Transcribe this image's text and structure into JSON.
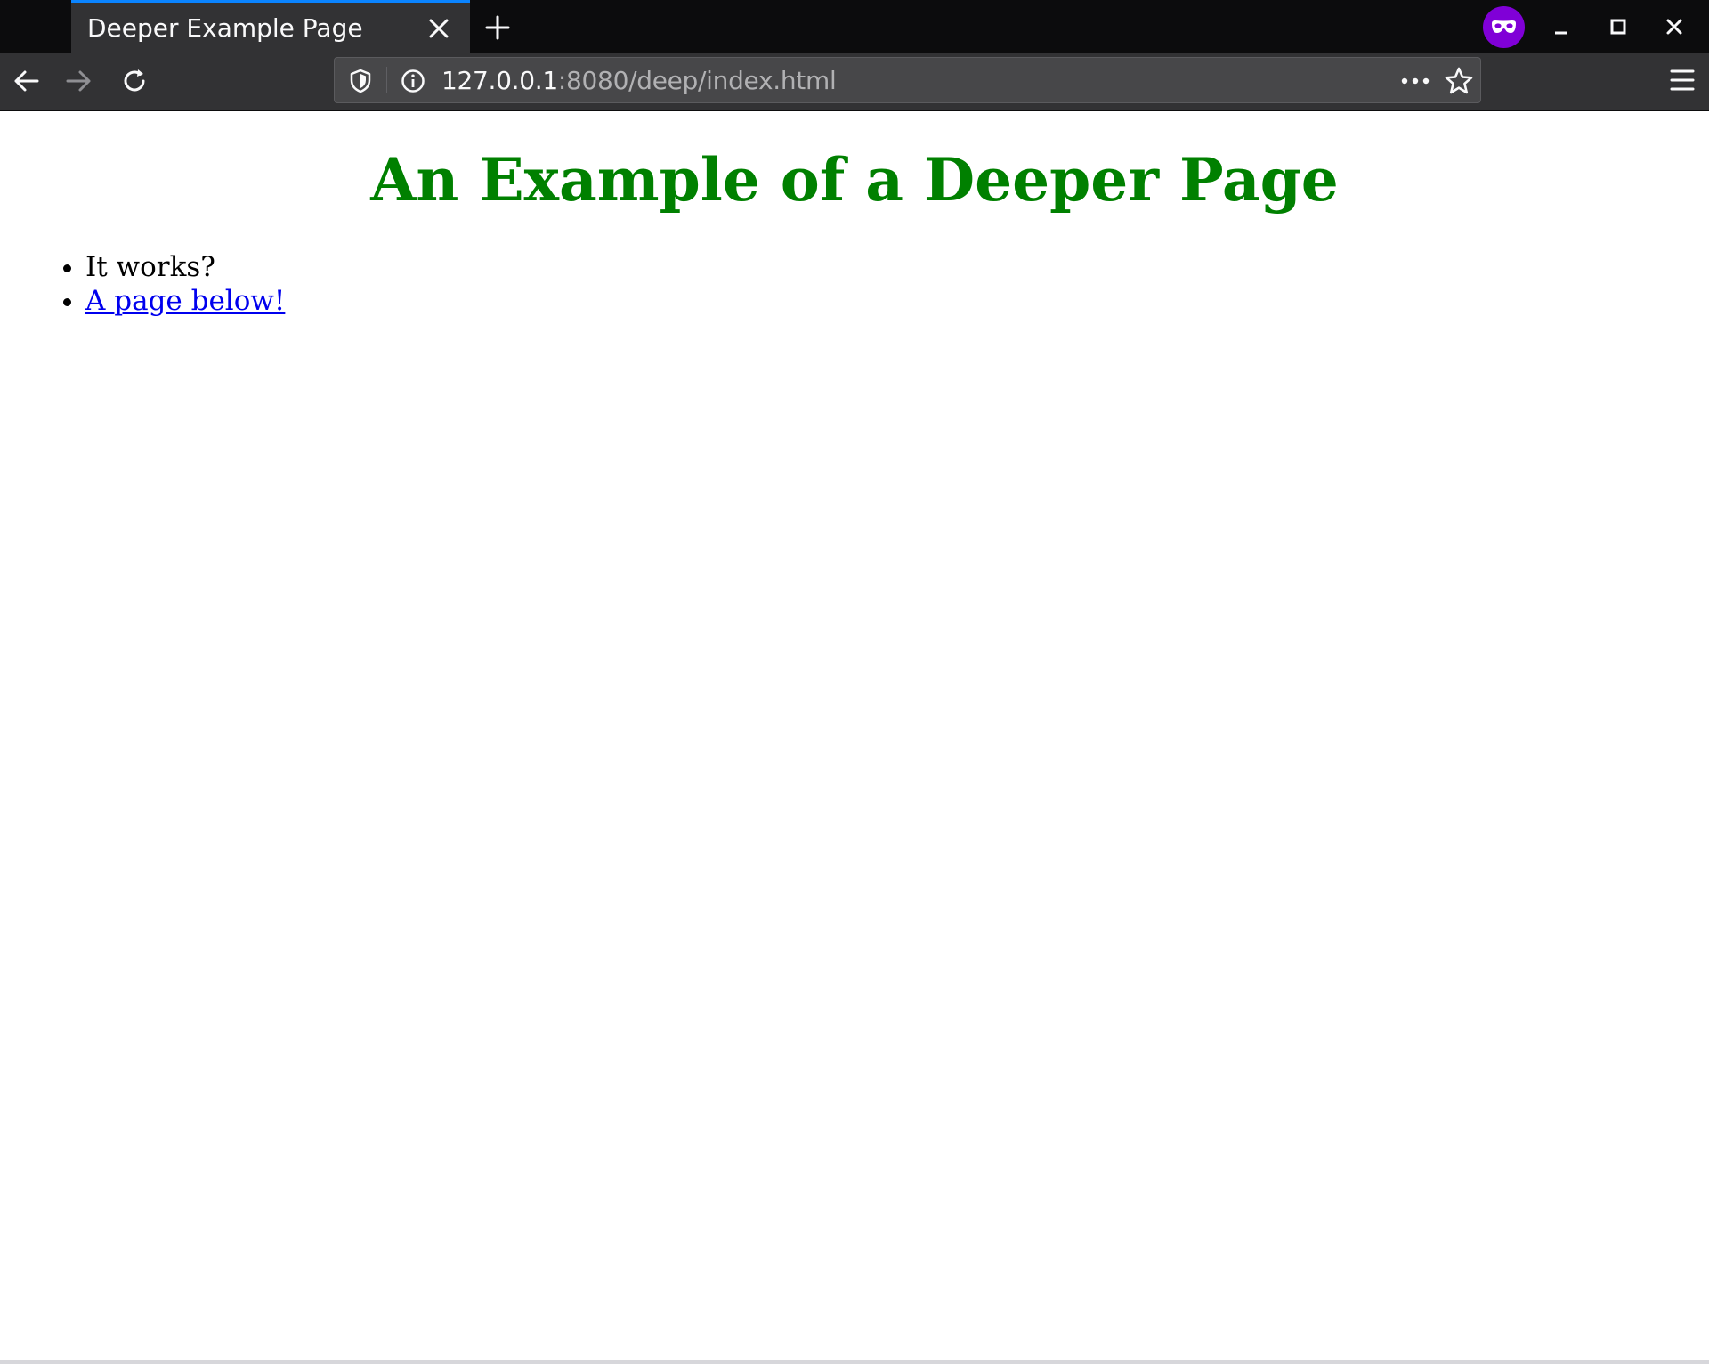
{
  "browser": {
    "tab": {
      "title": "Deeper Example Page"
    },
    "address_bar": {
      "url_host": "127.0.0.1",
      "url_rest": ":8080/deep/index.html"
    },
    "colors": {
      "tab_accent": "#0a84ff",
      "private_badge": "#8000d7",
      "chrome_dark": "#0c0c0d",
      "toolbar": "#323234"
    },
    "icons": [
      "close-icon",
      "plus-icon",
      "private-mask-icon",
      "minimize-icon",
      "maximize-icon",
      "window-close-icon",
      "back-arrow-icon",
      "forward-arrow-icon",
      "reload-icon",
      "shield-icon",
      "info-icon",
      "more-dots-icon",
      "bookmark-star-icon",
      "hamburger-menu-icon"
    ]
  },
  "page": {
    "heading": "An Example of a Deeper Page",
    "heading_color": "#008000",
    "list": [
      {
        "text": "It works?"
      },
      {
        "text": "A page below!",
        "is_link": true
      }
    ]
  }
}
